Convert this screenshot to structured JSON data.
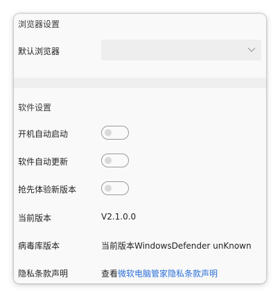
{
  "browser_section": {
    "title": "浏览器设置",
    "default_browser_label": "默认浏览器",
    "default_browser_value": ""
  },
  "software_section": {
    "title": "软件设置",
    "autostart_label": "开机自动启动",
    "autostart_on": false,
    "autoupdate_label": "软件自动更新",
    "autoupdate_on": false,
    "beta_label": "抢先体验新版本",
    "beta_on": false,
    "version_label": "当前版本",
    "version_value": "V2.1.0.0",
    "virus_db_label": "病毒库版本",
    "virus_db_value": "当前版本WindowsDefender unKnown",
    "privacy_label": "隐私条款声明",
    "privacy_prefix": "查看",
    "privacy_link": "微软电脑管家隐私条款声明"
  },
  "colors": {
    "link": "#2a6fd6",
    "card_bg": "#f9f9f9",
    "band": "#efefef"
  },
  "icons": {
    "select_arrow": "chevron-down-icon"
  }
}
